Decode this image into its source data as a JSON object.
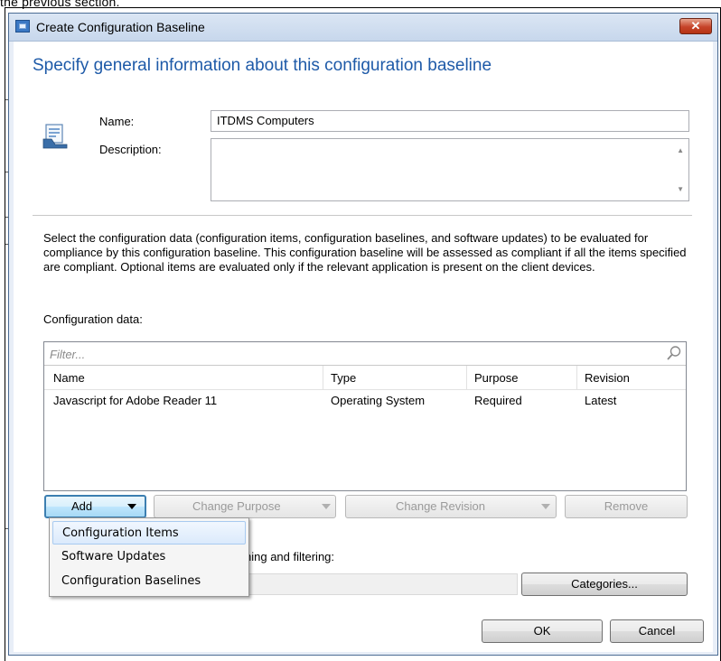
{
  "background": {
    "caption": "the previous section."
  },
  "window": {
    "title": "Create Configuration Baseline",
    "close_glyph": "✕"
  },
  "page": {
    "heading": "Specify general information about this configuration baseline",
    "name_label": "Name:",
    "name_value": "ITDMS Computers",
    "description_label": "Description:",
    "description_value": "",
    "info_text": "Select the configuration data (configuration items, configuration baselines, and software updates) to be evaluated for compliance by this configuration baseline. This configuration baseline will be assessed as compliant if all the items specified are compliant. Optional items are evaluated only if the relevant application is present on the client devices.",
    "config_label": "Configuration data:",
    "search_label": "hing and filtering:"
  },
  "filter": {
    "placeholder": "Filter...",
    "icon": "search-icon"
  },
  "grid": {
    "columns": [
      "Name",
      "Type",
      "Purpose",
      "Revision"
    ],
    "rows": [
      {
        "name": "Javascript for Adobe Reader 11",
        "type": "Operating System",
        "purpose": "Required",
        "revision": "Latest"
      }
    ]
  },
  "buttons": {
    "add": "Add",
    "change_purpose": "Change Purpose",
    "change_revision": "Change Revision",
    "remove": "Remove",
    "categories": "Categories...",
    "ok": "OK",
    "cancel": "Cancel"
  },
  "menu": {
    "items": [
      "Configuration Items",
      "Software Updates",
      "Configuration Baselines"
    ],
    "highlighted": "Configuration Items"
  },
  "colors": {
    "heading": "#1e5aa8",
    "title_bar": "#c7d7ec",
    "close_button": "#c6442a",
    "menu_highlight": "#dbeafc"
  }
}
